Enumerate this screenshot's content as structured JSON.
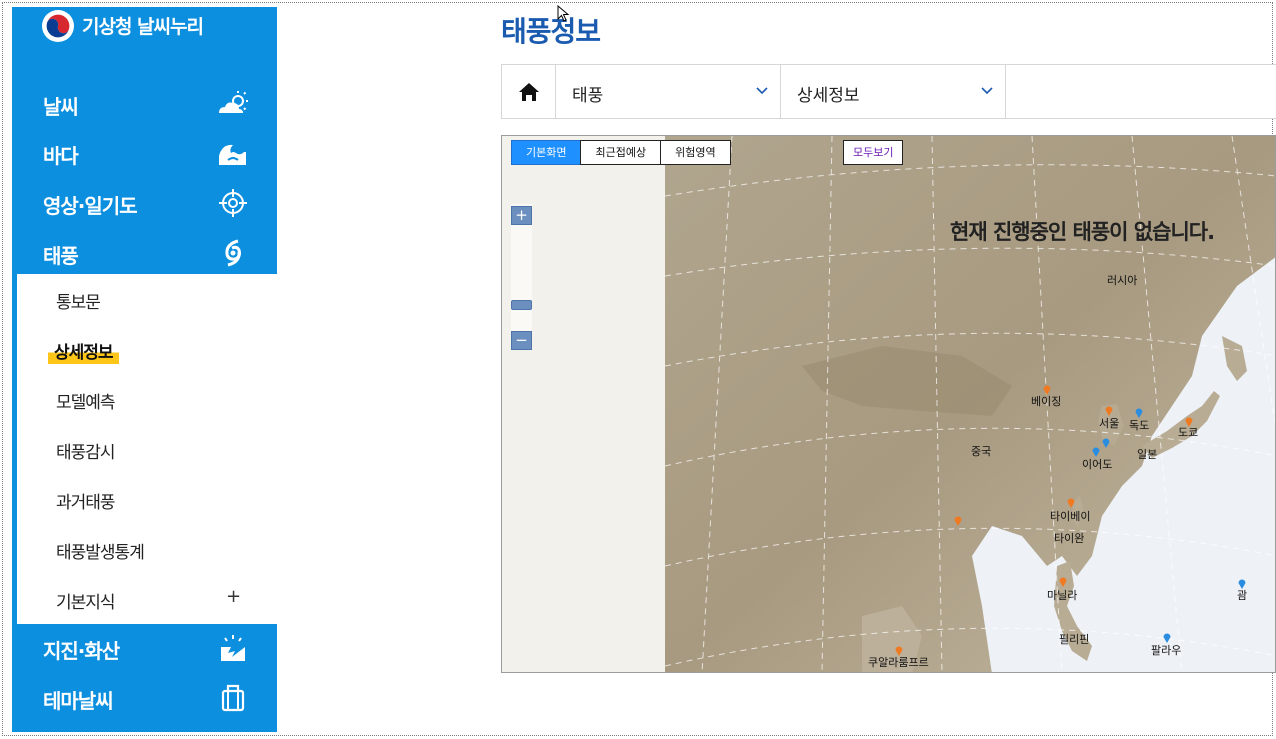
{
  "brand": {
    "name": "기상청 날씨누리"
  },
  "nav_top": [
    {
      "label": "날씨",
      "icon": "cloud-sun-icon"
    },
    {
      "label": "바다",
      "icon": "wave-icon"
    },
    {
      "label": "영상·일기도",
      "icon": "satellite-target-icon"
    },
    {
      "label": "태풍",
      "icon": "typhoon-icon"
    }
  ],
  "sub_menu": [
    {
      "label": "통보문"
    },
    {
      "label": "상세정보",
      "active": true
    },
    {
      "label": "모델예측"
    },
    {
      "label": "태풍감시"
    },
    {
      "label": "과거태풍"
    },
    {
      "label": "태풍발생통계"
    },
    {
      "label": "기본지식",
      "expand": "+"
    }
  ],
  "nav_bottom": [
    {
      "label": "지진·화산",
      "icon": "earthquake-icon"
    },
    {
      "label": "테마날씨",
      "icon": "suitcase-icon"
    }
  ],
  "page": {
    "title": "태풍정보"
  },
  "breadcrumb": {
    "level1": "태풍",
    "level2": "상세정보"
  },
  "map": {
    "tabs": [
      "기본화면",
      "최근접예상",
      "위험영역"
    ],
    "active_tab": "기본화면",
    "view_all": "모두보기",
    "zoom_in": "+",
    "zoom_out": "−",
    "message": "현재 진행중인 태풍이 없습니다.",
    "places": {
      "russia": "러시아",
      "beijing": "베이징",
      "seoul": "서울",
      "dokdo": "독도",
      "tokyo": "도쿄",
      "china": "중국",
      "ieodo": "이어도",
      "japan": "일본",
      "taipei": "타이베이",
      "taiwan": "타이완",
      "manila": "마닐라",
      "guam": "괌",
      "philippines": "필리핀",
      "palau": "팔라우",
      "kualalumpur": "쿠알라룸프르"
    },
    "colors": {
      "land": "#b9aa90",
      "sea": "#eef2f7",
      "pin_city": "#f07a22",
      "pin_point": "#2a8de0"
    }
  }
}
